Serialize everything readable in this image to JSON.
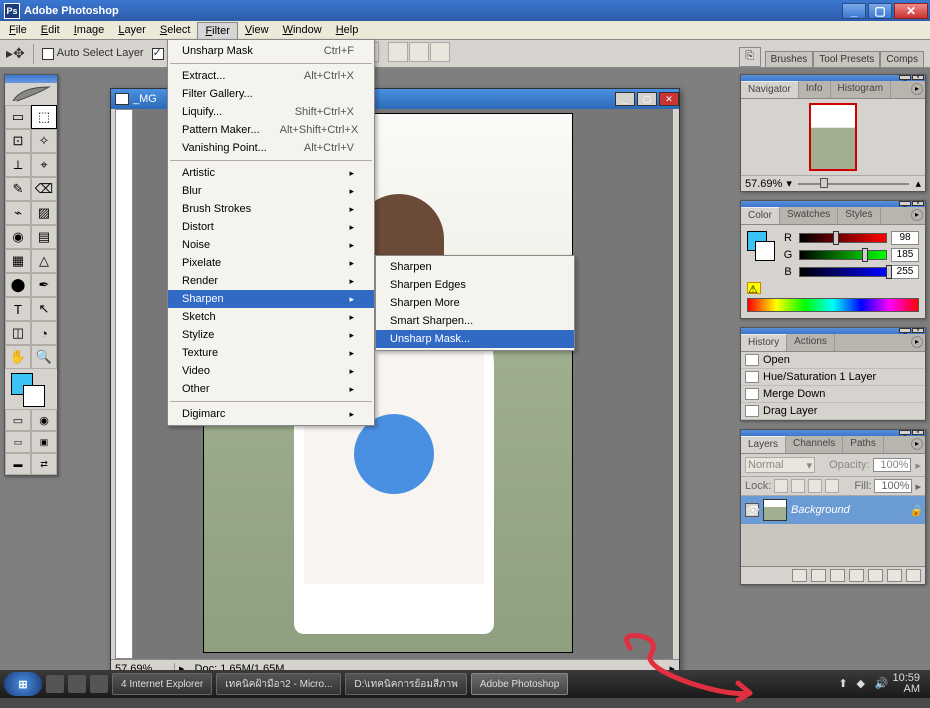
{
  "app": {
    "title": "Adobe Photoshop"
  },
  "menu": {
    "items": [
      "File",
      "Edit",
      "Image",
      "Layer",
      "Select",
      "Filter",
      "View",
      "Window",
      "Help"
    ],
    "open_index": 5
  },
  "filter_menu": {
    "top": [
      {
        "l": "Unsharp Mask",
        "sc": "Ctrl+F"
      }
    ],
    "convert": [
      {
        "l": "Extract...",
        "sc": "Alt+Ctrl+X"
      },
      {
        "l": "Filter Gallery...",
        "sc": ""
      },
      {
        "l": "Liquify...",
        "sc": "Shift+Ctrl+X"
      },
      {
        "l": "Pattern Maker...",
        "sc": "Alt+Shift+Ctrl+X"
      },
      {
        "l": "Vanishing Point...",
        "sc": "Alt+Ctrl+V"
      }
    ],
    "groups": [
      "Artistic",
      "Blur",
      "Brush Strokes",
      "Distort",
      "Noise",
      "Pixelate",
      "Render",
      "Sharpen",
      "Sketch",
      "Stylize",
      "Texture",
      "Video",
      "Other"
    ],
    "groups_hov_index": 7,
    "bottom": [
      {
        "l": "Digimarc"
      }
    ],
    "sharpen_sub": [
      "Sharpen",
      "Sharpen Edges",
      "Sharpen More",
      "Smart Sharpen...",
      "Unsharp Mask..."
    ],
    "sharpen_hov_index": 4
  },
  "optbar": {
    "auto_select_label": "Auto Select Layer",
    "auto_select_checked": false,
    "show_checked": true
  },
  "palette_well": [
    "Brushes",
    "Tool Presets",
    "Comps"
  ],
  "toolbox": {
    "tools": [
      "▭",
      "⬚",
      "⊡",
      "✧",
      "⟂",
      "⌖",
      "✎",
      "⌫",
      "⌁",
      "▨",
      "◉",
      "▤",
      "▦",
      "△",
      "⬤",
      "✒",
      "T",
      "↖",
      "◫",
      "◔",
      "✋",
      "🔍"
    ]
  },
  "doc": {
    "title": "_MG",
    "zoom": "57.69%",
    "size": "Doc: 1.65M/1.65M"
  },
  "panels": {
    "navigator": {
      "tabs": [
        "Navigator",
        "Info",
        "Histogram"
      ],
      "zoom": "57.69%"
    },
    "color": {
      "tabs": [
        "Color",
        "Swatches",
        "Styles"
      ],
      "channels": [
        {
          "l": "R",
          "v": "98",
          "c": "linear-gradient(to right,#000,#f00)",
          "p": "38%"
        },
        {
          "l": "G",
          "v": "185",
          "c": "linear-gradient(to right,#000,#0f0)",
          "p": "72%"
        },
        {
          "l": "B",
          "v": "255",
          "c": "linear-gradient(to right,#000,#00f)",
          "p": "100%"
        }
      ]
    },
    "history": {
      "tabs": [
        "History",
        "Actions"
      ],
      "items": [
        "Open",
        "Hue/Saturation 1 Layer",
        "Merge Down",
        "Drag Layer"
      ]
    },
    "layers": {
      "tabs": [
        "Layers",
        "Channels",
        "Paths"
      ],
      "mode": "Normal",
      "opacity_label": "Opacity:",
      "opacity": "100%",
      "lock_label": "Lock:",
      "fill_label": "Fill:",
      "fill": "100%",
      "layer_name": "Background"
    }
  },
  "taskbar": {
    "items": [
      {
        "l": "4 Internet Explorer",
        "act": false
      },
      {
        "l": "เทคนิคฝ้ามือา2 - Micro...",
        "act": false
      },
      {
        "l": "D:\\เทคนิคการย้อมสีภาพ",
        "act": false
      },
      {
        "l": "Adobe Photoshop",
        "act": true
      }
    ],
    "time": "10:59",
    "ampm": "AM"
  }
}
